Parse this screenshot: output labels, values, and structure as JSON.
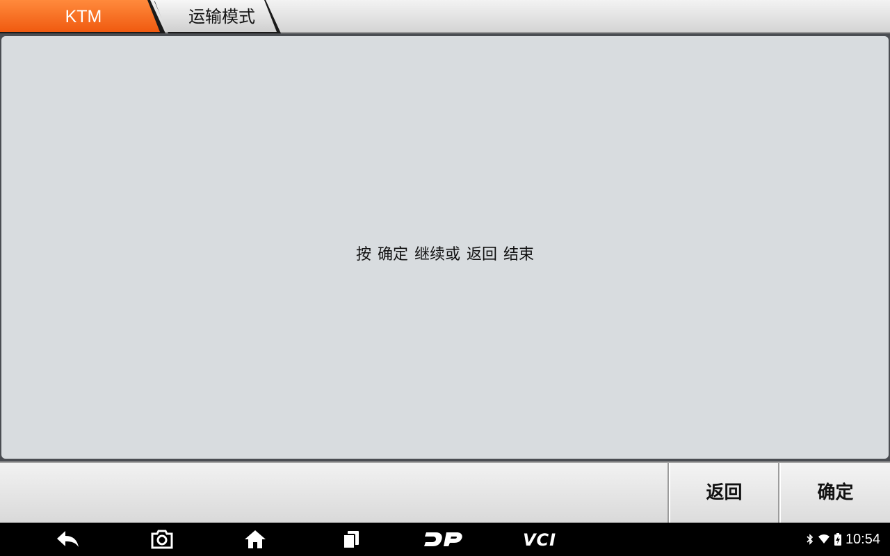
{
  "breadcrumb": {
    "items": [
      {
        "label": "KTM"
      },
      {
        "label": "运输模式"
      }
    ]
  },
  "main": {
    "message": "按 确定 继续或 返回 结束"
  },
  "buttons": {
    "back_label": "返回",
    "ok_label": "确定"
  },
  "navbar": {
    "icons": [
      "back-arrow-icon",
      "camera-icon",
      "home-icon",
      "recent-apps-icon",
      "dp-logo-icon",
      "vci-logo-icon"
    ],
    "vci_text": "VCI",
    "dp_text": "DP"
  },
  "status_bar": {
    "time": "10:54",
    "icons": [
      "bluetooth-icon",
      "wifi-icon",
      "battery-icon"
    ]
  },
  "colors": {
    "accent": "#f26a1b",
    "panel": "#d8dcdf",
    "navbar": "#000000"
  }
}
